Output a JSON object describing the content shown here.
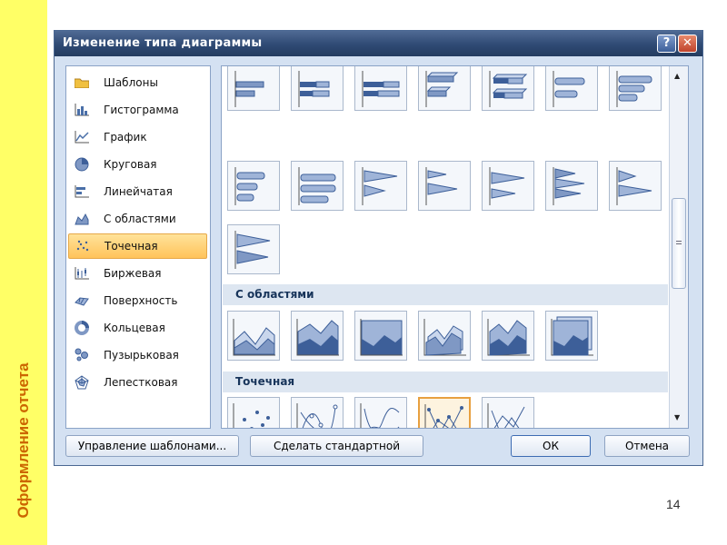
{
  "slide": {
    "side_title": "Оформление отчета",
    "page_number": "14"
  },
  "dialog": {
    "title": "Изменение типа диаграммы",
    "help_label": "?",
    "close_label": "✕",
    "categories": [
      {
        "label": "Шаблоны",
        "icon": "folder-icon"
      },
      {
        "label": "Гистограмма",
        "icon": "column-chart-icon"
      },
      {
        "label": "График",
        "icon": "line-chart-icon"
      },
      {
        "label": "Круговая",
        "icon": "pie-chart-icon"
      },
      {
        "label": "Линейчатая",
        "icon": "bar-chart-icon"
      },
      {
        "label": "С областями",
        "icon": "area-chart-icon"
      },
      {
        "label": "Точечная",
        "icon": "scatter-chart-icon",
        "selected": true
      },
      {
        "label": "Биржевая",
        "icon": "stock-chart-icon"
      },
      {
        "label": "Поверхность",
        "icon": "surface-chart-icon"
      },
      {
        "label": "Кольцевая",
        "icon": "doughnut-chart-icon"
      },
      {
        "label": "Пузырьковая",
        "icon": "bubble-chart-icon"
      },
      {
        "label": "Лепестковая",
        "icon": "radar-chart-icon"
      }
    ],
    "sections": {
      "area": "С областями",
      "scatter": "Точечная"
    },
    "buttons": {
      "manage_templates": "Управление шаблонами...",
      "set_default": "Сделать стандартной",
      "ok": "ОК",
      "cancel": "Отмена"
    },
    "colors": {
      "accent": "#3d5f99",
      "selection": "#ffc35a",
      "chart_fill": "#7f98c4"
    }
  }
}
